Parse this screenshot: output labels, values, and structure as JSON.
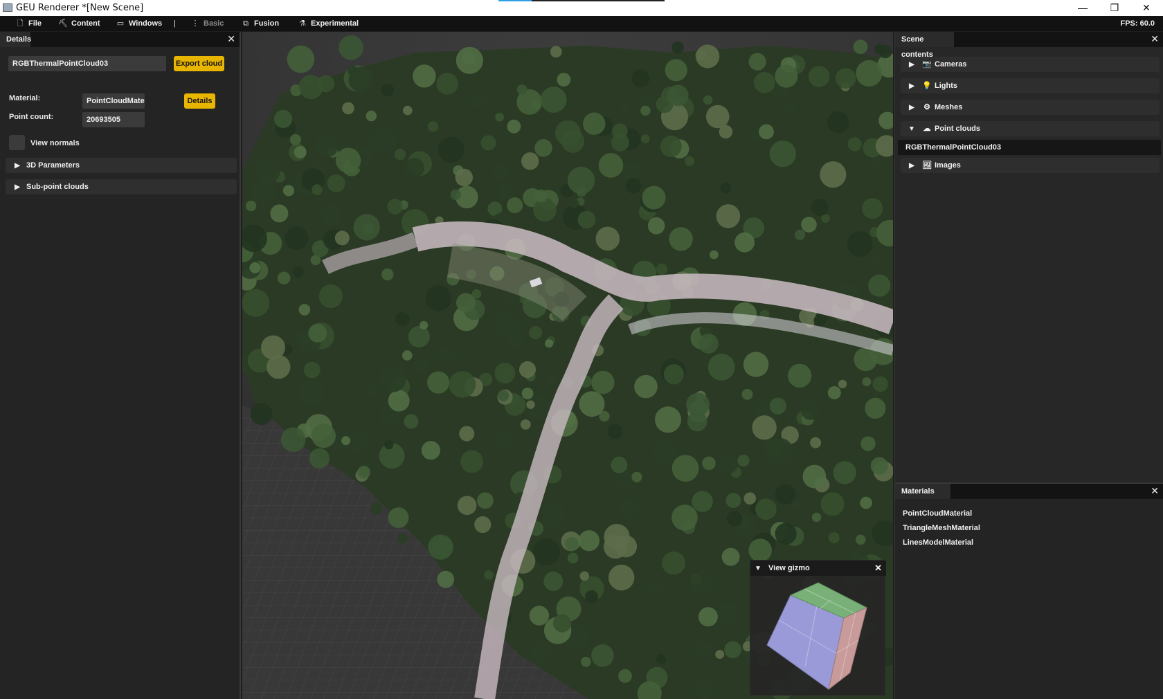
{
  "window": {
    "title": "GEU Renderer *[New Scene]",
    "progress_fraction": 0.2,
    "controls": {
      "minimize": "—",
      "restore": "❐",
      "close": "✕"
    }
  },
  "menubar": {
    "items": [
      {
        "label": "File",
        "icon": "file-icon"
      },
      {
        "label": "Content",
        "icon": "content-icon"
      },
      {
        "label": "Windows",
        "icon": "monitor-icon"
      },
      {
        "label": "|",
        "icon": ""
      },
      {
        "label": "Basic",
        "icon": "vertical-dots-icon",
        "disabled": true
      },
      {
        "label": "Fusion",
        "icon": "fusion-icon"
      },
      {
        "label": "Experimental",
        "icon": "flask-icon"
      }
    ],
    "fps": "FPS: 60.0"
  },
  "details": {
    "tab": "Details",
    "cloud_name": "RGBThermalPointCloud03",
    "export_label": "Export cloud",
    "material_label": "Material:",
    "material_value": "PointCloudMater",
    "details_button": "Details",
    "point_count_label": "Point count:",
    "point_count_value": "20693505",
    "view_normals_label": "View normals",
    "view_normals_checked": false,
    "sections": [
      "3D Parameters",
      "Sub-point clouds"
    ]
  },
  "scene": {
    "tab": "Scene contents",
    "nodes": [
      {
        "label": "Cameras",
        "icon": "camera-icon",
        "expanded": false
      },
      {
        "label": "Lights",
        "icon": "lightbulb-icon",
        "expanded": false
      },
      {
        "label": "Meshes",
        "icon": "meshes-icon",
        "expanded": false
      },
      {
        "label": "Point clouds",
        "icon": "cloud-icon",
        "expanded": true,
        "children": [
          "RGBThermalPointCloud03"
        ]
      },
      {
        "label": "Images",
        "icon": "image-icon",
        "expanded": false
      }
    ]
  },
  "materials": {
    "tab": "Materials",
    "items": [
      "PointCloudMaterial",
      "TriangleMeshMaterial",
      "LinesModelMaterial"
    ]
  },
  "gizmo": {
    "title": "View gizmo",
    "face_colors": {
      "front": "#9a9ad8",
      "top": "#78b078",
      "right": "#c99a9a"
    }
  },
  "viewport": {
    "colors": {
      "sky": "#3a3a3a",
      "grid": "#474747",
      "road": "#cbbcc3",
      "tree": "#2f4428",
      "grass": "#6a7456"
    }
  }
}
